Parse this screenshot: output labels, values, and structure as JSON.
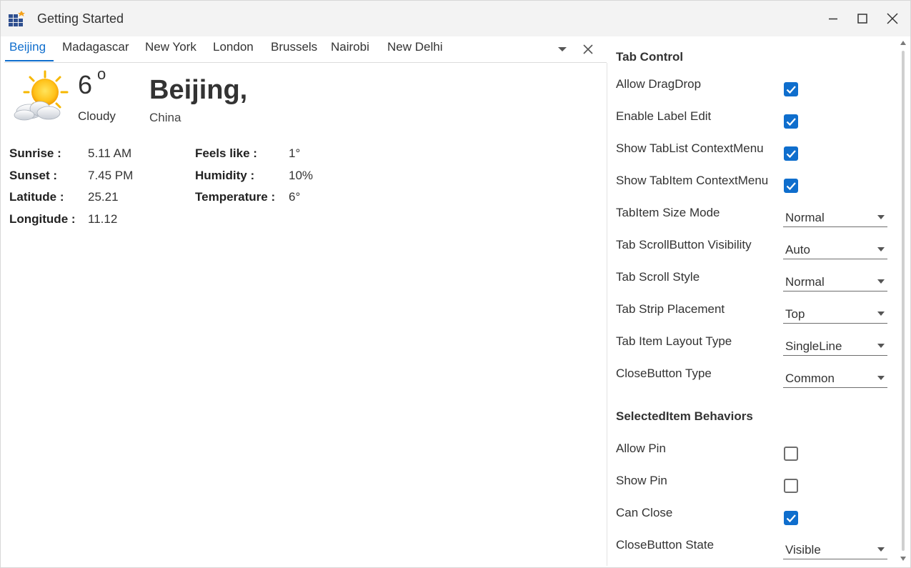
{
  "window": {
    "title": "Getting Started"
  },
  "tabs": [
    {
      "label": "Beijing",
      "selected": true
    },
    {
      "label": "Madagascar",
      "selected": false
    },
    {
      "label": "New York",
      "selected": false
    },
    {
      "label": "London",
      "selected": false
    },
    {
      "label": "Brussels",
      "selected": false
    },
    {
      "label": "Nairobi",
      "selected": false
    },
    {
      "label": "New Delhi",
      "selected": false
    }
  ],
  "weather": {
    "temperature": "6",
    "degree_symbol": "o",
    "condition": "Cloudy",
    "city": "Beijing,",
    "country": "China",
    "icon": "partly-sunny-icon",
    "details": {
      "sunrise_label": "Sunrise :",
      "sunrise_value": "5.11 AM",
      "sunset_label": "Sunset :",
      "sunset_value": "7.45 PM",
      "latitude_label": "Latitude :",
      "latitude_value": "25.21",
      "longitude_label": "Longitude :",
      "longitude_value": "11.12",
      "feels_like_label": "Feels like :",
      "feels_like_value": "1°",
      "humidity_label": "Humidity :",
      "humidity_value": "10%",
      "temperature_label": "Temperature :",
      "temperature_value": "6°"
    }
  },
  "panel": {
    "tab_control_header": "Tab Control",
    "allow_dragdrop": {
      "label": "Allow DragDrop",
      "checked": true
    },
    "enable_label_edit": {
      "label": "Enable Label Edit",
      "checked": true
    },
    "show_tablist_contextmenu": {
      "label": "Show TabList ContextMenu",
      "checked": true
    },
    "show_tabitem_contextmenu": {
      "label": "Show TabItem ContextMenu",
      "checked": true
    },
    "tabitem_size_mode": {
      "label": "TabItem Size Mode",
      "value": "Normal"
    },
    "tab_scrollbutton_visibility": {
      "label": "Tab ScrollButton Visibility",
      "value": "Auto"
    },
    "tab_scroll_style": {
      "label": "Tab Scroll Style",
      "value": "Normal"
    },
    "tab_strip_placement": {
      "label": "Tab Strip Placement",
      "value": "Top"
    },
    "tab_item_layout_type": {
      "label": "Tab Item Layout Type",
      "value": "SingleLine"
    },
    "closebutton_type": {
      "label": "CloseButton Type",
      "value": "Common"
    },
    "selecteditem_header": "SelectedItem Behaviors",
    "allow_pin": {
      "label": "Allow Pin",
      "checked": false
    },
    "show_pin": {
      "label": "Show Pin",
      "checked": false
    },
    "can_close": {
      "label": "Can Close",
      "checked": true
    },
    "closebutton_state": {
      "label": "CloseButton State",
      "value": "Visible"
    }
  },
  "colors": {
    "accent": "#0f6ecd",
    "titlebar_bg": "#f3f3f3",
    "text": "#333333"
  }
}
